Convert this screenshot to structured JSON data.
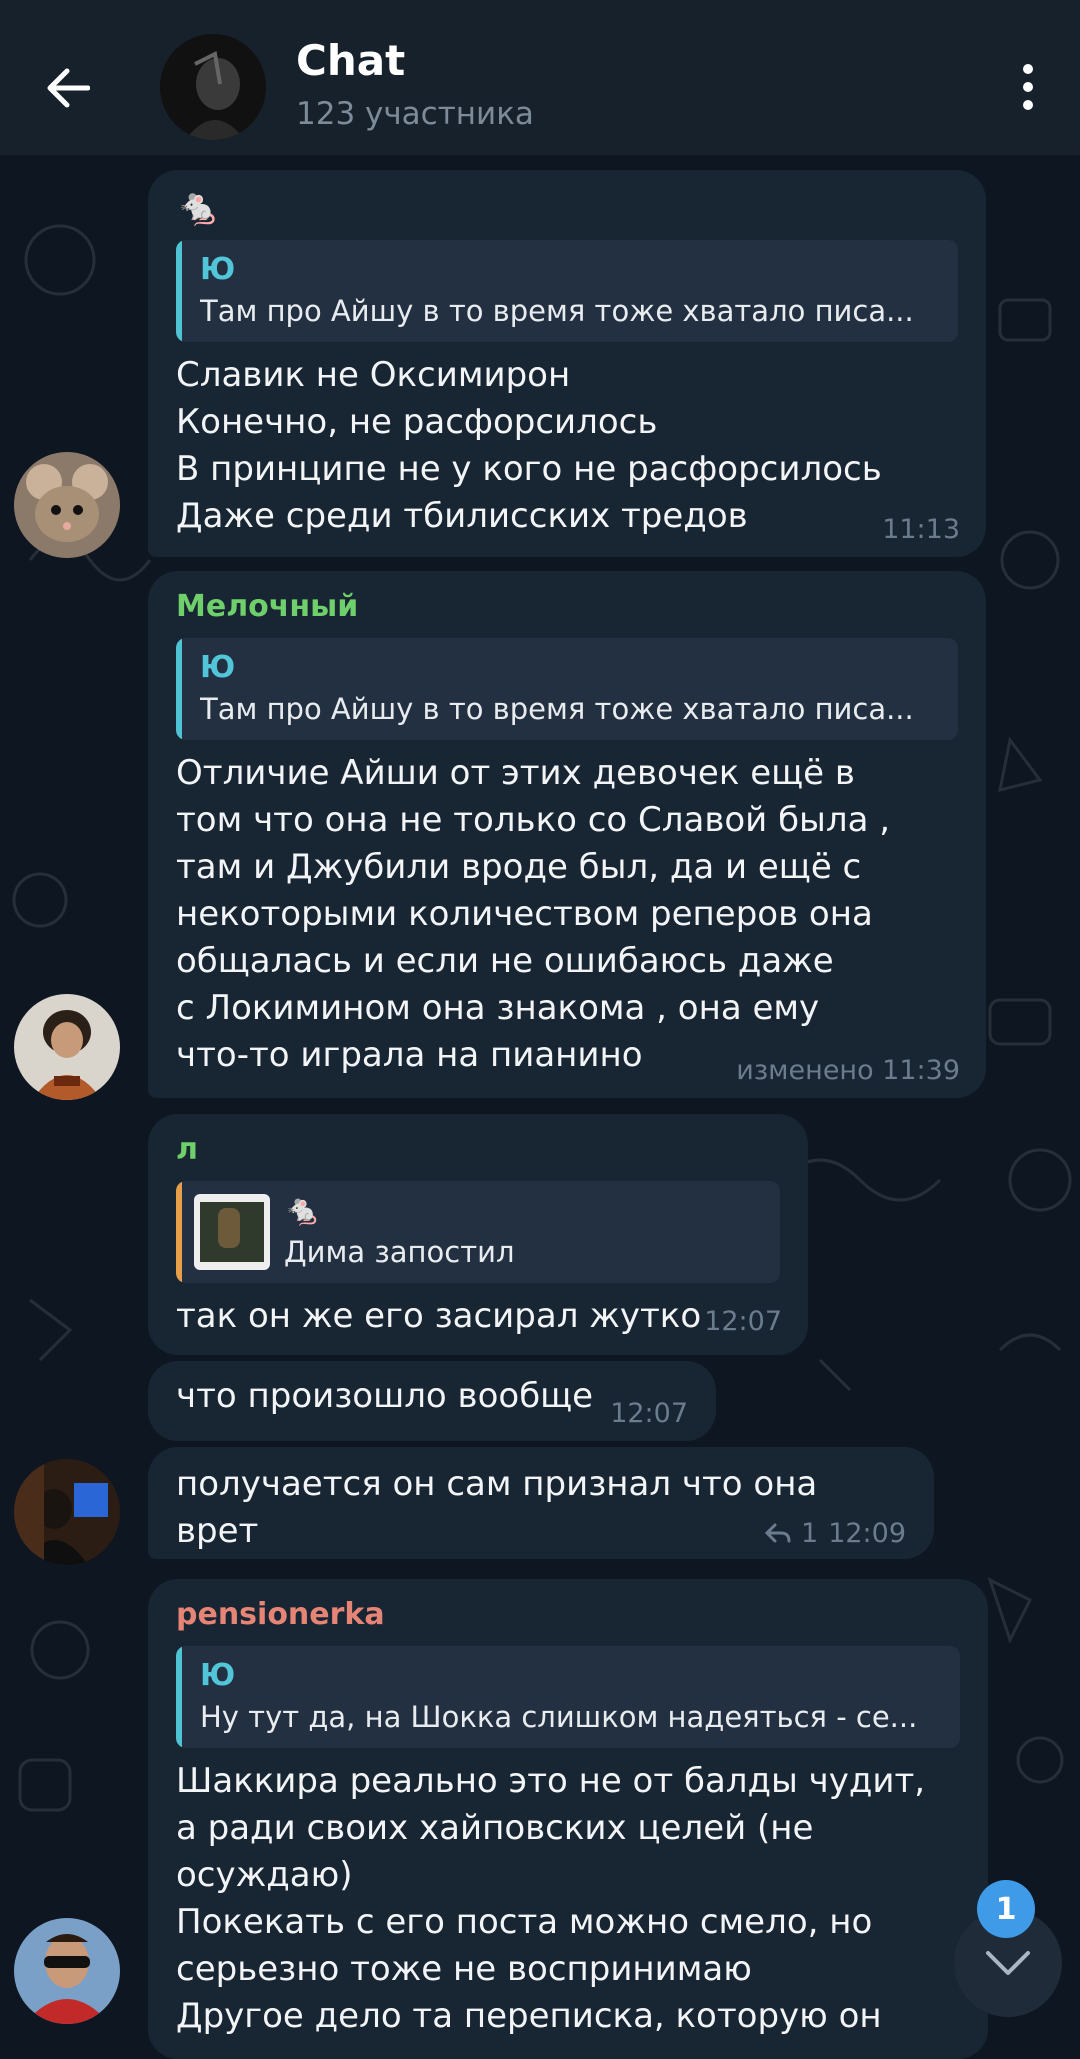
{
  "header": {
    "title": "Chat",
    "subtitle": "123 участника"
  },
  "messages": [
    {
      "sender": "🐁",
      "reply": {
        "name": "Ю",
        "text": "Там про Айшу в то время тоже хватало писа..."
      },
      "text": "Славик не Оксимирон\nКонечно, не расфорсилось\nВ принципе не у кого не расфорсилось\nДаже среди тбилисских тредов",
      "time": "11:13"
    },
    {
      "sender": "Мелочный",
      "reply": {
        "name": "Ю",
        "text": "Там про Айшу в то время тоже хватало писа..."
      },
      "text": "Отличие Айши от этих девочек ещё в\nтом что она не только со Славой была ,\nтам и Джубили вроде был, да и ещё с\nнекоторыми количеством реперов она\nобщалась и если не ошибаюсь даже\nс Локимином она знакома ,  она ему\nчто-то играла на пианино",
      "time": "изменено 11:39"
    },
    {
      "sender": "л",
      "reply": {
        "name": "🐁",
        "text": "Дима запостил"
      },
      "text": "так он же его засирал жутко",
      "time": "12:07"
    },
    {
      "text": "что произошло вообще",
      "time": "12:07"
    },
    {
      "text": "получается он сам признал что она врет",
      "reply_count": "1",
      "time": "12:09"
    },
    {
      "sender": "pensionerka",
      "reply": {
        "name": "Ю",
        "text": "Ну тут да, на Шокка слишком надеяться - се..."
      },
      "text": "Шаккира реально это не от балды чудит,\nа ради своих хайповских целей (не\nосуждаю)\nПокекать с его поста можно смело, но\nсерьезно тоже не воспринимаю\nДругое дело та переписка, которую он"
    }
  ],
  "unread_count": "1",
  "colors": {
    "background": "#0e1621",
    "header": "#17212b",
    "bubble": "#182533",
    "accent_reply": "#4fc3d4",
    "sender_green": "#6fcf6a",
    "sender_pink": "#e68575"
  }
}
